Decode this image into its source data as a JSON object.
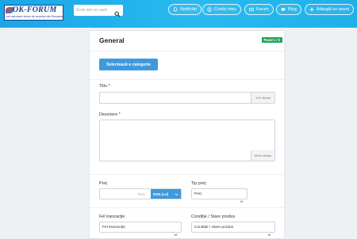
{
  "header": {
    "logo_text": "OK-FORUM",
    "logo_sub": "cel mai mare forum de anunturi din Romania",
    "search_placeholder": "Scrie aici ce cauti",
    "nav": [
      {
        "label": "Notificări",
        "icon": "bell-icon"
      },
      {
        "label": "Contul meu",
        "icon": "user-icon"
      },
      {
        "label": "Forum",
        "icon": "forum-icon"
      },
      {
        "label": "Blog",
        "icon": "chat-icon"
      },
      {
        "label": "Adaugă un anunț",
        "icon": "plus-icon"
      }
    ]
  },
  "form": {
    "title": "General",
    "step": "Pasul 1 / 3",
    "category_button": "Selectează o categorie",
    "title_label": "Titlu *",
    "title_counter": "100 rămas",
    "description_label": "Descriere *",
    "description_counter": "5000 rămas",
    "price_label": "Preț",
    "price_placeholder": "Preț",
    "currency": "RON (Lei)",
    "price_type_label": "Tip preț",
    "price_type_value": "Preț",
    "transaction_label": "Fel tranzacție",
    "transaction_value": "Fel tranzacție",
    "condition_label": "Condiție / Stare produs",
    "condition_value": "Condiție / Stare produs"
  },
  "colors": {
    "header": "#1fb0ea",
    "primary_button": "#3f99dd",
    "step_badge": "#21a356"
  }
}
